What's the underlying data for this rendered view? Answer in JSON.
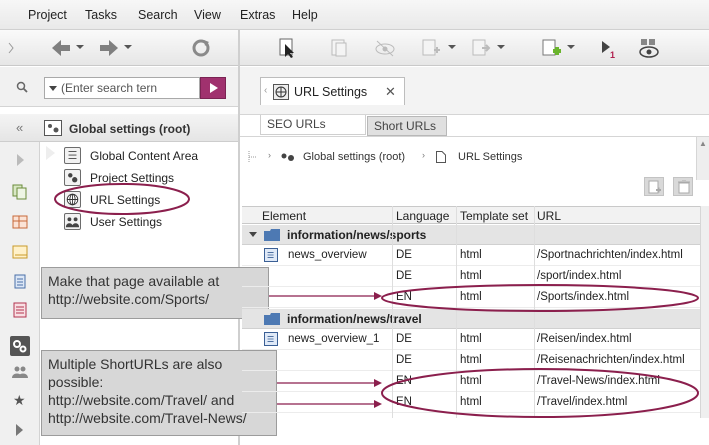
{
  "menu": {
    "items": [
      "Project",
      "Tasks",
      "Search",
      "View",
      "Extras",
      "Help"
    ]
  },
  "search": {
    "placeholder": "(Enter search tern"
  },
  "left_panel": {
    "title": "Global settings (root)",
    "items": [
      {
        "label": "Global Content Area",
        "icon": "content-area-icon"
      },
      {
        "label": "Project Settings",
        "icon": "project-settings-icon"
      },
      {
        "label": "URL Settings",
        "icon": "globe-icon"
      },
      {
        "label": "User Settings",
        "icon": "user-settings-icon"
      }
    ]
  },
  "tabs": {
    "open_tab": "URL Settings",
    "sub_tabs": [
      "SEO URLs",
      "Short URLs"
    ]
  },
  "breadcrumb": {
    "items": [
      "Global settings (root)",
      "URL Settings"
    ]
  },
  "table": {
    "columns": [
      "Element",
      "Language",
      "Template set",
      "URL"
    ],
    "groups": [
      {
        "name": "information/news/sports",
        "rows": [
          {
            "element": "news_overview",
            "language": "DE",
            "template": "html",
            "url": "/Sportnachrichten/index.html"
          },
          {
            "element": "",
            "language": "DE",
            "template": "html",
            "url": "/sport/index.html"
          },
          {
            "element": "",
            "language": "EN",
            "template": "html",
            "url": "/Sports/index.html"
          }
        ]
      },
      {
        "name": "information/news/travel",
        "rows": [
          {
            "element": "news_overview_1",
            "language": "DE",
            "template": "html",
            "url": "/Reisen/index.html"
          },
          {
            "element": "",
            "language": "DE",
            "template": "html",
            "url": "/Reisenachrichten/index.html"
          },
          {
            "element": "",
            "language": "EN",
            "template": "html",
            "url": "/Travel-News/index.html"
          },
          {
            "element": "",
            "language": "EN",
            "template": "html",
            "url": "/Travel/index.html"
          }
        ]
      }
    ]
  },
  "callouts": {
    "first": [
      "Make that page available at",
      "http://website.com/Sports/"
    ],
    "second": [
      "Multiple ShortURLs are also",
      "possible:",
      "http://website.com/Travel/ and",
      "http://website.com/Travel-News/"
    ]
  },
  "colors": {
    "highlight_oval": "#8b1f4d",
    "search_button": "#a0316e",
    "group_folder": "#4d79b3"
  }
}
